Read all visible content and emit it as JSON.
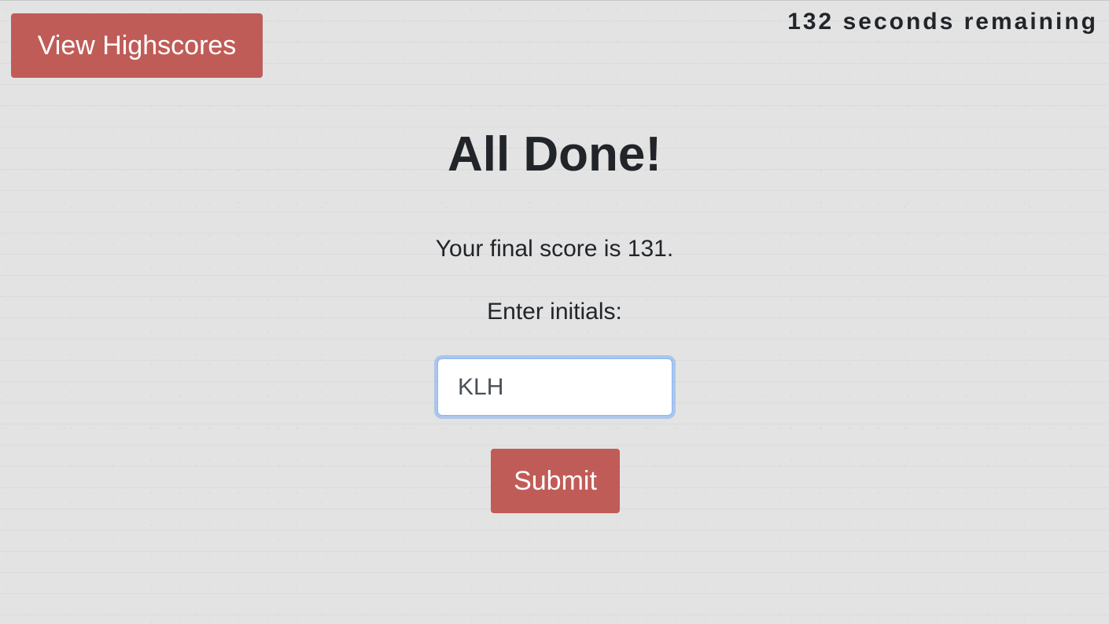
{
  "header": {
    "highscores_label": "View Highscores",
    "timer_text": "132 seconds remaining"
  },
  "main": {
    "title": "All Done!",
    "score_text": "Your final score is 131.",
    "initials_label": "Enter initials:",
    "initials_value": "KLH",
    "submit_label": "Submit"
  },
  "colors": {
    "button_red": "#c05c58",
    "background": "#e3e3e3",
    "focus_ring": "#86b7fe"
  }
}
